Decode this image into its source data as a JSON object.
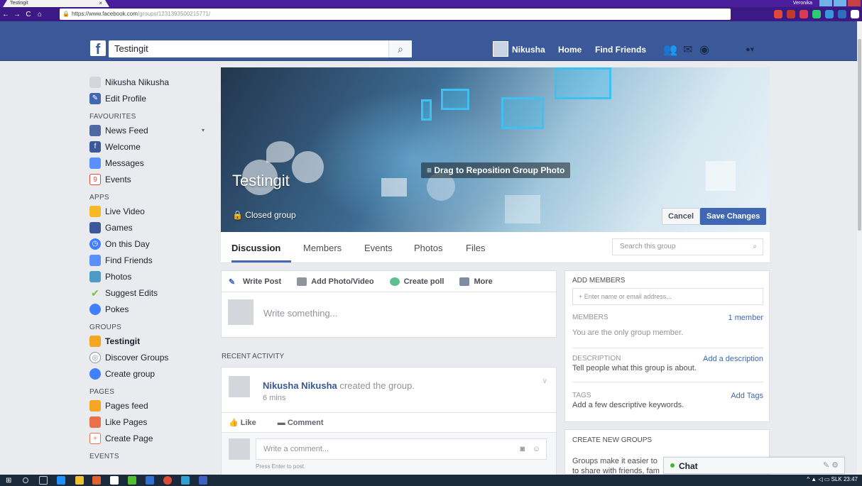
{
  "browser": {
    "tab_title": "Testingit",
    "tab_close": "×",
    "url_host": "https://www.facebook.com",
    "url_path": "/groups/1231393500215771/",
    "window_user": "Veronika"
  },
  "topbar": {
    "search_value": "Testingit",
    "user_name": "Nikusha",
    "home_label": "Home",
    "find_friends_label": "Find Friends"
  },
  "sidebar": {
    "profile_name": "Nikusha Nikusha",
    "edit_profile": "Edit Profile",
    "favourites_head": "FAVOURITES",
    "favourites": [
      {
        "label": "News Feed",
        "icon": "news-feed-icon",
        "color": "#4e69a2"
      },
      {
        "label": "Welcome",
        "icon": "facebook-icon",
        "color": "#3b5998"
      },
      {
        "label": "Messages",
        "icon": "messages-icon",
        "color": "#5890ff"
      },
      {
        "label": "Events",
        "icon": "events-icon",
        "color": "#e24b3b"
      }
    ],
    "apps_head": "APPS",
    "apps": [
      {
        "label": "Live Video",
        "icon": "live-video-icon",
        "color": "#f7b928"
      },
      {
        "label": "Games",
        "icon": "games-icon",
        "color": "#3b5998"
      },
      {
        "label": "On this Day",
        "icon": "on-this-day-icon",
        "color": "#4080ff"
      },
      {
        "label": "Find Friends",
        "icon": "find-friends-icon",
        "color": "#5890ff"
      },
      {
        "label": "Photos",
        "icon": "photos-icon",
        "color": "#4e9ac9"
      },
      {
        "label": "Suggest Edits",
        "icon": "suggest-edits-icon",
        "color": "#7ac143"
      },
      {
        "label": "Pokes",
        "icon": "pokes-icon",
        "color": "#4080ff"
      }
    ],
    "groups_head": "GROUPS",
    "groups": [
      {
        "label": "Testingit",
        "icon": "group-icon",
        "color": "#f5a623"
      },
      {
        "label": "Discover Groups",
        "icon": "discover-groups-icon",
        "color": "#90949c"
      },
      {
        "label": "Create group",
        "icon": "create-group-icon",
        "color": "#4080ff"
      }
    ],
    "pages_head": "PAGES",
    "pages": [
      {
        "label": "Pages feed",
        "icon": "pages-feed-icon",
        "color": "#f5a623"
      },
      {
        "label": "Like Pages",
        "icon": "like-pages-icon",
        "color": "#e9704a"
      },
      {
        "label": "Create Page",
        "icon": "create-page-icon",
        "color": "#e9704a"
      }
    ],
    "events_head": "EVENTS"
  },
  "cover": {
    "group_name": "Testingit",
    "privacy": "Closed group",
    "drag_hint": "Drag to Reposition Group Photo",
    "cancel": "Cancel",
    "save": "Save Changes"
  },
  "tabs": {
    "items": [
      "Discussion",
      "Members",
      "Events",
      "Photos",
      "Files"
    ],
    "search_placeholder": "Search this group"
  },
  "composer": {
    "write_post": "Write Post",
    "add_photo": "Add Photo/Video",
    "create_poll": "Create poll",
    "more": "More",
    "placeholder": "Write something..."
  },
  "recent": {
    "heading": "RECENT ACTIVITY",
    "author": "Nikusha Nikusha",
    "action": "created the group.",
    "time": "6 mins",
    "like": "Like",
    "comment": "Comment",
    "comment_placeholder": "Write a comment...",
    "comment_hint": "Press Enter to post."
  },
  "right": {
    "add_members_head": "ADD MEMBERS",
    "add_members_placeholder": "+ Enter name or email address...",
    "members_head": "MEMBERS",
    "members_count": "1 member",
    "members_text": "You are the only group member.",
    "description_head": "DESCRIPTION",
    "description_link": "Add a description",
    "description_text": "Tell people what this group is about.",
    "tags_head": "TAGS",
    "tags_link": "Add Tags",
    "tags_text": "Add a few descriptive keywords.",
    "create_head": "CREATE NEW GROUPS",
    "create_text_1": "Groups make it easier to",
    "create_text_2": "to share with friends, fam"
  },
  "chat": {
    "label": "Chat"
  },
  "taskbar": {
    "clock": "23:47",
    "lang": "SLK"
  }
}
